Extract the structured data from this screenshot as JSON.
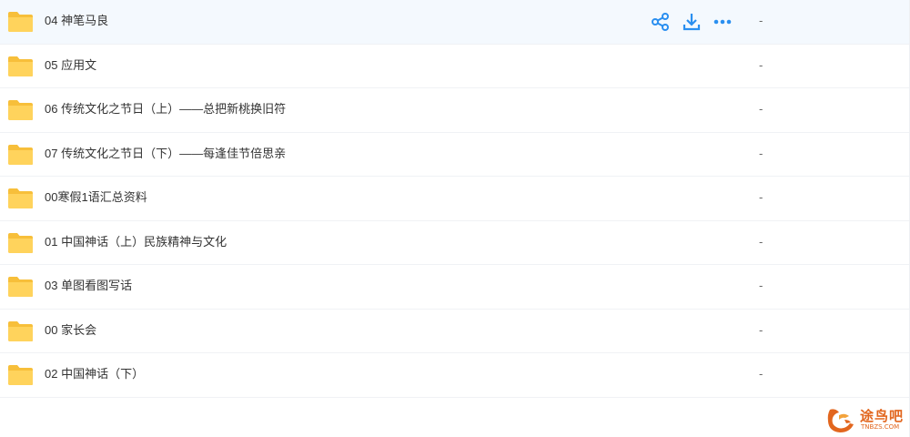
{
  "colors": {
    "accent": "#2a8ff0",
    "folder": "#ffd35c",
    "folder_dark": "#f7bf3a",
    "hover": "#f4f9fe",
    "watermark": "#e2661e"
  },
  "hover_actions": {
    "icons": [
      "share-icon",
      "download-icon",
      "more-icon"
    ]
  },
  "files": [
    {
      "name": "04 神笔马良",
      "size": "-",
      "hovered": true,
      "icon": "folder-icon"
    },
    {
      "name": "05 应用文",
      "size": "-",
      "icon": "folder-icon"
    },
    {
      "name": "06 传统文化之节日（上）——总把新桃换旧符",
      "size": "-",
      "icon": "folder-icon"
    },
    {
      "name": "07 传统文化之节日（下）——每逢佳节倍思亲",
      "size": "-",
      "icon": "folder-icon"
    },
    {
      "name": "00寒假1语汇总资料",
      "size": "-",
      "icon": "folder-icon"
    },
    {
      "name": "01 中国神话（上）民族精神与文化",
      "size": "-",
      "icon": "folder-icon"
    },
    {
      "name": "03 单图看图写话",
      "size": "-",
      "icon": "folder-icon"
    },
    {
      "name": "00 家长会",
      "size": "-",
      "icon": "folder-icon"
    },
    {
      "name": "02 中国神话（下）",
      "size": "-",
      "icon": "folder-icon"
    }
  ],
  "watermark": {
    "name": "途鸟吧",
    "domain": "TNBZS.COM"
  }
}
